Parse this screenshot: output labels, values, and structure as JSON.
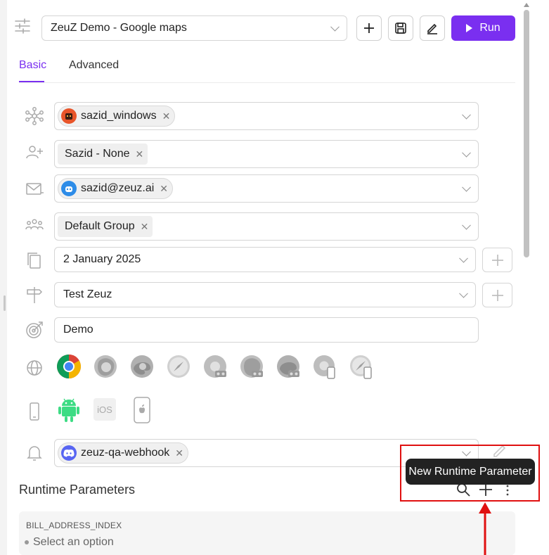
{
  "header": {
    "flow_name": "ZeuZ Demo - Google maps",
    "run_label": "Run"
  },
  "tabs": [
    {
      "label": "Basic",
      "active": true
    },
    {
      "label": "Advanced",
      "active": false
    }
  ],
  "fields": {
    "node": "sazid_windows",
    "assignee": "Sazid - None",
    "email": "sazid@zeuz.ai",
    "group": "Default Group",
    "date": "2 January 2025",
    "milestone": "Test Zeuz",
    "objective": "Demo"
  },
  "browsers": [
    "chrome",
    "firefox",
    "edge",
    "safari",
    "chrome-headless",
    "firefox-headless",
    "edge-headless",
    "chrome-mobile",
    "safari-mobile"
  ],
  "mobile": {
    "ios_label": "iOS"
  },
  "notification": {
    "webhook": "zeuz-qa-webhook"
  },
  "runtime": {
    "title": "Runtime Parameters",
    "param_name": "BILL_ADDRESS_INDEX",
    "param_placeholder": "Select an option",
    "tooltip": "New Runtime Parameter"
  },
  "colors": {
    "accent": "#7a2ff0",
    "annotation": "#e01010"
  }
}
